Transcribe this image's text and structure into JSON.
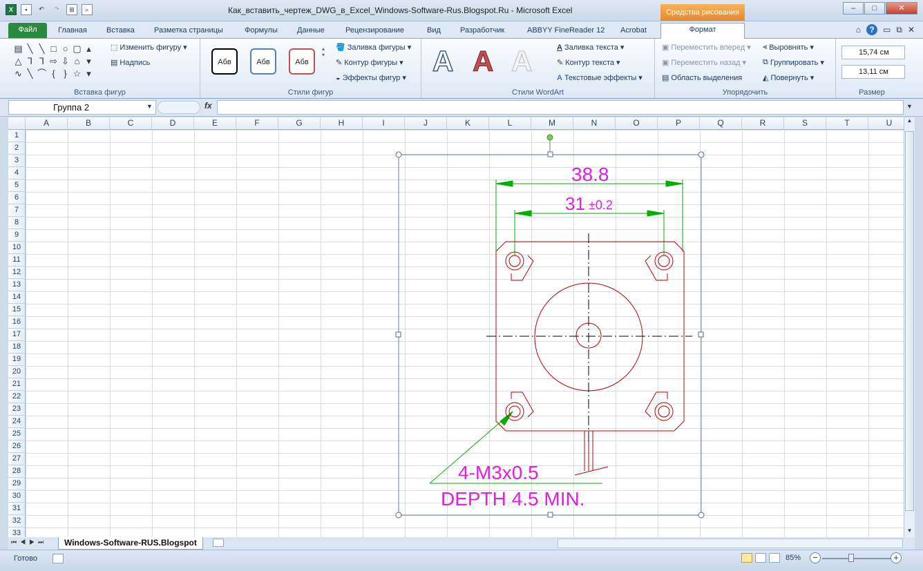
{
  "title": "Как_вставить_чертеж_DWG_в_Excel_Windows-Software-Rus.Blogspot.Ru  -  Microsoft Excel",
  "context_tab_title": "Средства рисования",
  "tabs": [
    "Файл",
    "Главная",
    "Вставка",
    "Разметка страницы",
    "Формулы",
    "Данные",
    "Рецензирование",
    "Вид",
    "Разработчик",
    "ABBYY FineReader 12",
    "Acrobat",
    "Формат"
  ],
  "ribbon": {
    "insert_shapes": {
      "change_shape": "Изменить фигуру",
      "text_box": "Надпись",
      "label": "Вставка фигур"
    },
    "shape_styles": {
      "sample": "Абв",
      "fill": "Заливка фигуры",
      "outline": "Контур фигуры",
      "effects": "Эффекты фигур",
      "label": "Стили фигур"
    },
    "wordart": {
      "text_fill": "Заливка текста",
      "text_outline": "Контур текста",
      "text_effects": "Текстовые эффекты",
      "label": "Стили WordArt",
      "letter": "A"
    },
    "arrange": {
      "bring_forward": "Переместить вперед",
      "send_backward": "Переместить назад",
      "selection_pane": "Область выделения",
      "align": "Выровнять",
      "group": "Группировать",
      "rotate": "Повернуть",
      "label": "Упорядочить"
    },
    "size": {
      "height": "15,74 см",
      "width": "13,11 см",
      "label": "Размер"
    }
  },
  "formula_bar": {
    "name_box": "Группа 2",
    "fx": "fx"
  },
  "columns": [
    "A",
    "B",
    "C",
    "D",
    "E",
    "F",
    "G",
    "H",
    "I",
    "J",
    "K",
    "L",
    "M",
    "N",
    "O",
    "P",
    "Q",
    "R",
    "S",
    "T",
    "U"
  ],
  "rows": [
    "1",
    "2",
    "3",
    "4",
    "5",
    "6",
    "7",
    "8",
    "9",
    "10",
    "11",
    "12",
    "13",
    "14",
    "15",
    "16",
    "17",
    "18",
    "19",
    "20",
    "21",
    "22",
    "23",
    "24",
    "25",
    "26",
    "27",
    "28",
    "29",
    "30",
    "31",
    "32",
    "33"
  ],
  "drawing": {
    "dim_outer": "38.8",
    "dim_inner": "31",
    "dim_tol": "±0.2",
    "note_line1": "4-M3x0.5",
    "note_line2": "DEPTH 4.5 MIN.",
    "line_color": "#c00000",
    "text_color": "#e020e0",
    "dim_color": "#00b000"
  },
  "sheet_tab": "Windows-Software-RUS.Blogspot",
  "status": {
    "ready": "Готово",
    "zoom": "85%"
  }
}
